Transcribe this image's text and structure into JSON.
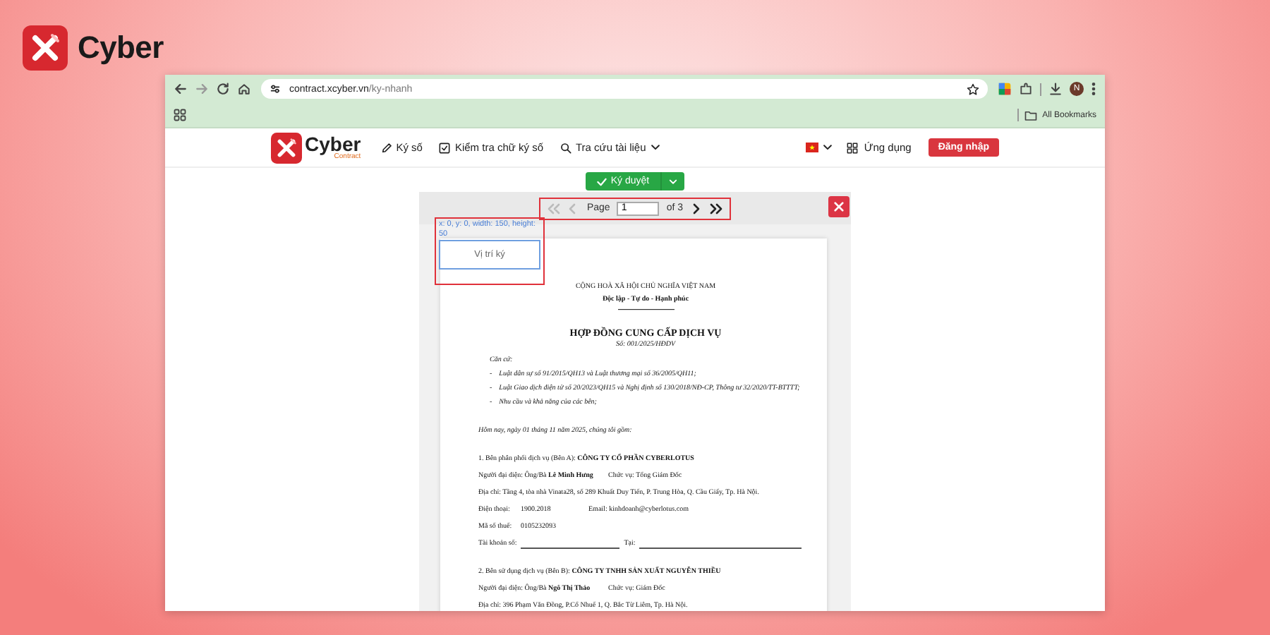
{
  "brand": {
    "name": "Cyber"
  },
  "browser": {
    "url_host": "contract.xcyber.vn",
    "url_path": "/ky-nhanh",
    "profile_initial": "N",
    "bookmarks_folder": "All Bookmarks"
  },
  "site": {
    "logo": {
      "name": "Cyber",
      "tagline": "Contract"
    },
    "nav": [
      {
        "kind": "pen",
        "label": "Ký số",
        "dropdown": false
      },
      {
        "kind": "check",
        "label": "Kiểm tra chữ ký số",
        "dropdown": false
      },
      {
        "kind": "search",
        "label": "Tra cứu tài liệu",
        "dropdown": true
      }
    ],
    "apps": "Ứng dụng",
    "login": "Đăng nhập"
  },
  "viewer": {
    "approve": "Ký duyệt",
    "pager": {
      "page_label": "Page",
      "page_value": "1",
      "total": "of 3",
      "buttons": [
        {
          "kind": "first",
          "disabled": true
        },
        {
          "kind": "prev",
          "disabled": true
        },
        {
          "kind": "next",
          "disabled": false
        },
        {
          "kind": "last",
          "disabled": false
        }
      ]
    },
    "signature": {
      "coords": "x: 0, y: 0, width: 150, height: 50",
      "label": "Vị trí ký"
    },
    "document": [
      {
        "kind": "center",
        "text": "CỘNG HOÀ XÃ HỘI CHỦ NGHĨA VIỆT NAM"
      },
      {
        "kind": "motto",
        "text": "Độc lập - Tự do - Hạnh phúc"
      },
      {
        "kind": "title",
        "text": "HỢP ĐỒNG CUNG CẤP DỊCH VỤ"
      },
      {
        "kind": "number",
        "text": "Số: 001/2025/HĐDV"
      },
      {
        "kind": "note",
        "text": "Căn cứ:"
      },
      {
        "kind": "bullet",
        "marker": "-",
        "text": "Luật dân sự số 91/2015/QH13 và Luật thương mại số 36/2005/QH11;"
      },
      {
        "kind": "bullet",
        "marker": "-",
        "text": "Luật Giao dịch điện tử số 20/2023/QH15 và Nghị định số 130/2018/NĐ-CP, Thông tư 32/2020/TT-BTTTT;"
      },
      {
        "kind": "bullet",
        "marker": "-",
        "text": "Nhu cầu và khả năng của các bên;"
      },
      {
        "kind": "date",
        "text": "Hôm nay, ngày 01 tháng 11 năm 2025, chúng tôi gồm:"
      },
      {
        "kind": "section",
        "text": "1. Bên phân phối dịch vụ (Bên A): **CÔNG TY CỔ PHẦN CYBERLOTUS**"
      },
      {
        "kind": "pair",
        "cells": [
          "Người đại diện: Ông/Bà **Lê Minh Hưng**",
          "Chức vụ: Tổng Giám Đốc"
        ]
      },
      {
        "kind": "para",
        "text": "Địa chỉ: Tầng 4, tòa nhà Vinata28, số 289 Khuất Duy Tiến, P. Trung Hòa, Q. Cầu Giấy, Tp. Hà Nội."
      },
      {
        "kind": "field",
        "cells": [
          "Điện thoại:",
          "1900.2018",
          "Email: kinhdoanh@cyberlotus.com"
        ]
      },
      {
        "kind": "field",
        "cells": [
          "Mã số thuế:",
          "0105232093"
        ]
      },
      {
        "kind": "blanks",
        "cells": [
          "Tài khoản số:",
          "Tại:"
        ]
      },
      {
        "kind": "section",
        "text": "2. Bên sử dụng dịch vụ (Bên B): **CÔNG TY TNHH SẢN XUẤT NGUYỄN THIỀU**"
      },
      {
        "kind": "pair",
        "cells": [
          "Người đại diện: Ông/Bà **Ngô Thị Thảo**",
          "Chức vụ: Giám Đốc"
        ]
      },
      {
        "kind": "para",
        "text": "Địa chỉ: 396 Phạm Văn Đồng, P.Cổ Nhuế 1, Q. Bắc Từ Liêm, Tp. Hà Nội."
      }
    ]
  }
}
